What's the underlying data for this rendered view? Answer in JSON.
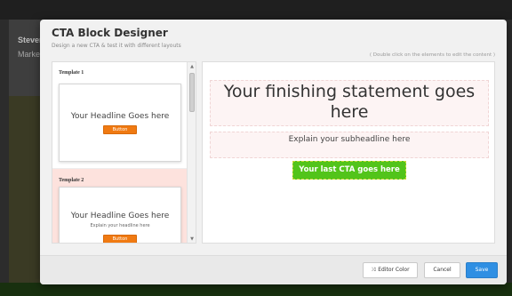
{
  "background": {
    "name": "Steven",
    "subtitle": "Marke"
  },
  "modal": {
    "title": "CTA Block Designer",
    "subtitle": "Design a new CTA & test it with different layouts",
    "hint": "( Double click on the elements to edit the content )"
  },
  "templates": [
    {
      "label": "Template 1",
      "headline": "Your Headline Goes here",
      "sub": "",
      "button": "Button"
    },
    {
      "label": "Template 2",
      "headline": "Your Headline Goes here",
      "sub": "Explain your headline here",
      "button": "Button"
    }
  ],
  "preview": {
    "headline": "Your finishing statement goes here",
    "subheadline": "Explain your subheadline here",
    "cta": "Your last CTA goes here"
  },
  "footer": {
    "editor_color_label": "Editor Color",
    "cancel_label": "Cancel",
    "save_label": "Save"
  },
  "colors": {
    "save": "#2f8fe3",
    "cta": "#52c41a",
    "template_button": "#f07a12",
    "selected_template": "#fde2dd"
  }
}
